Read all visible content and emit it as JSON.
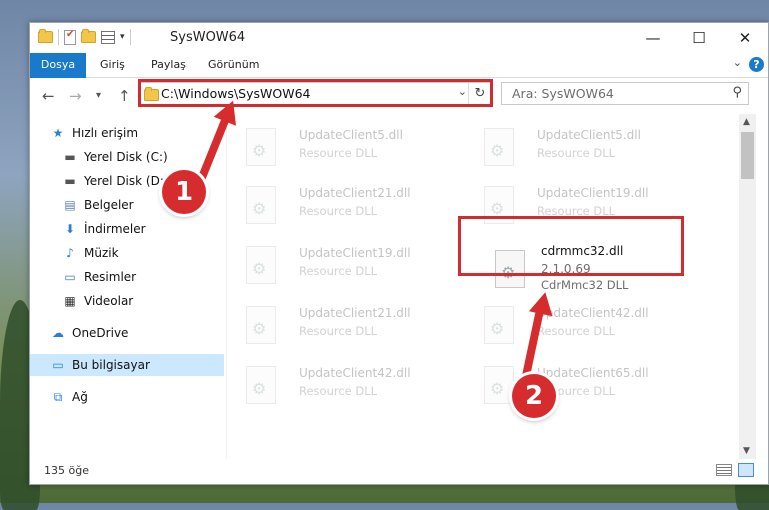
{
  "window": {
    "title": "SysWOW64"
  },
  "qat": {
    "dropdown_glyph": "▾"
  },
  "controls": {
    "minimize": "—",
    "maximize": "☐",
    "close": "✕"
  },
  "ribbon": {
    "tabs": [
      {
        "label": "Dosya"
      },
      {
        "label": "Giriş"
      },
      {
        "label": "Paylaş"
      },
      {
        "label": "Görünüm"
      }
    ],
    "help": "?"
  },
  "nav": {
    "back": "←",
    "forward": "→",
    "recent": "▾",
    "up": "↑",
    "address": "C:\\Windows\\SysWOW64",
    "search_placeholder": "Ara: SysWOW64"
  },
  "sidebar": {
    "items": [
      {
        "label": "Hızlı erişim",
        "icon": "star-icon"
      },
      {
        "label": "Yerel Disk (C:)",
        "icon": "drive-icon"
      },
      {
        "label": "Yerel Disk (D:)",
        "icon": "drive-icon"
      },
      {
        "label": "Belgeler",
        "icon": "documents-icon"
      },
      {
        "label": "İndirmeler",
        "icon": "download-icon"
      },
      {
        "label": "Müzik",
        "icon": "music-icon"
      },
      {
        "label": "Resimler",
        "icon": "pictures-icon"
      },
      {
        "label": "Videolar",
        "icon": "videos-icon"
      },
      {
        "label": "OneDrive",
        "icon": "cloud-icon"
      },
      {
        "label": "Bu bilgisayar",
        "icon": "computer-icon"
      },
      {
        "label": "Ağ",
        "icon": "network-icon"
      }
    ]
  },
  "files": [
    {
      "name": "UpdateClient5.dll",
      "desc": "Resource DLL"
    },
    {
      "name": "UpdateClient5.dll",
      "desc": "Resource DLL"
    },
    {
      "name": "UpdateClient21.dll",
      "desc": "Resource DLL"
    },
    {
      "name": "UpdateClient19.dll",
      "desc": "Resource DLL"
    },
    {
      "name": "UpdateClient19.dll",
      "desc": "Resource DLL"
    },
    {
      "name": "cdrmmc32.dll",
      "version": "2.1.0.69",
      "desc": "CdrMmc32 DLL"
    },
    {
      "name": "UpdateClient21.dll",
      "desc": "Resource DLL"
    },
    {
      "name": "UpdateClient42.dll",
      "desc": "Resource DLL"
    },
    {
      "name": "UpdateClient42.dll",
      "desc": "Resource DLL"
    },
    {
      "name": "UpdateClient65.dll",
      "desc": "Resource DLL"
    }
  ],
  "status": {
    "count": "135 öğe"
  },
  "callouts": [
    {
      "number": "1"
    },
    {
      "number": "2"
    }
  ],
  "colors": {
    "accent": "#1979ca",
    "highlight": "#d12d30",
    "selected": "#cce8ff"
  }
}
